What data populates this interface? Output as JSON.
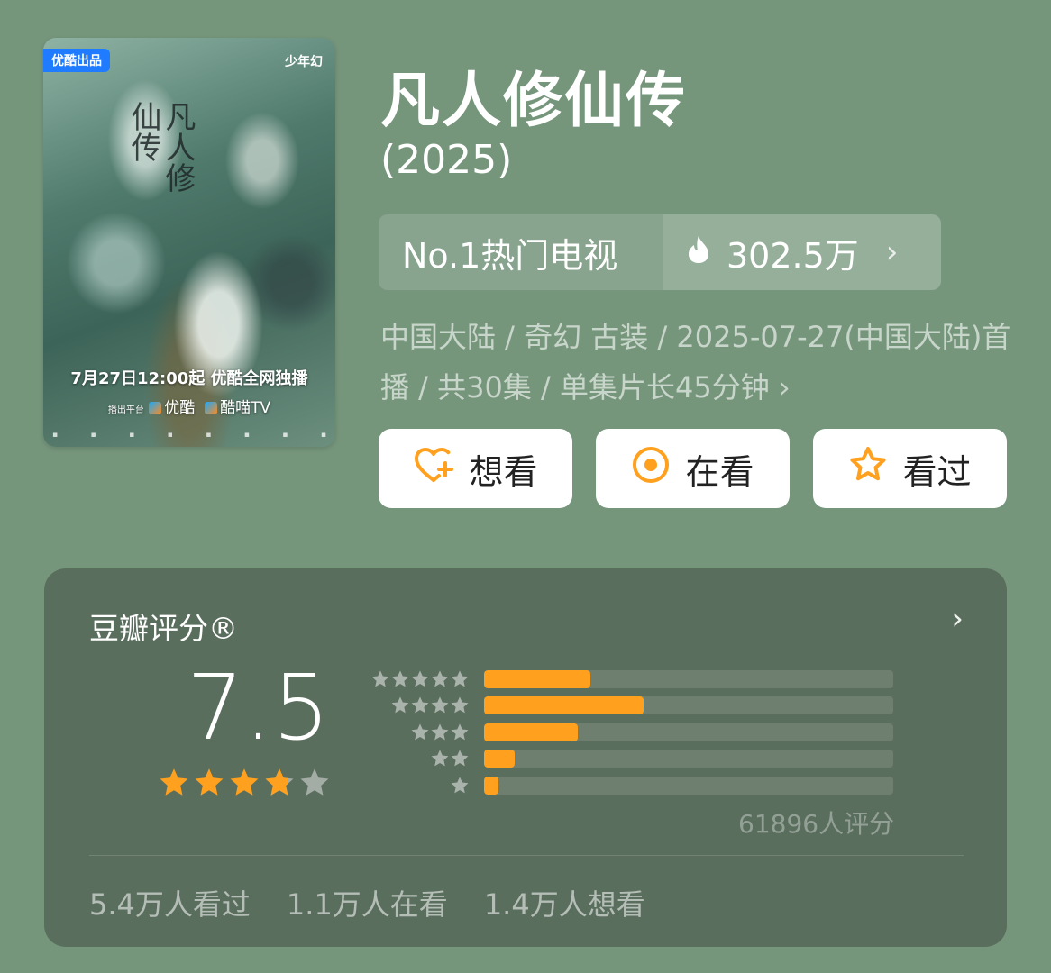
{
  "poster": {
    "badge": "优酷出品",
    "brand": "少年幻",
    "title_art": "凡人修仙传",
    "release": "7月27日12:00起 优酷全网独播",
    "platform_prefix": "播出平台",
    "platform_1": "优酷",
    "platform_2": "酷喵TV"
  },
  "title": "凡人修仙传",
  "year": "(2025)",
  "rank": {
    "label": "No.1热门电视",
    "heat": "302.5万",
    "chevron": "›"
  },
  "meta": {
    "line": "中国大陆 / 奇幻 古装 / 2025-07-27(中国大陆)首播 / 共30集 / 单集片长45分钟 ›"
  },
  "actions": [
    {
      "label": "想看",
      "icon": "heart-plus-icon"
    },
    {
      "label": "在看",
      "icon": "target-icon"
    },
    {
      "label": "看过",
      "icon": "star-outline-icon"
    }
  ],
  "rating": {
    "title": "豆瓣评分®",
    "chevron": "›",
    "score": "7.5",
    "stars": 3.75,
    "distribution": [
      {
        "stars": 5,
        "fraction": 0.26
      },
      {
        "stars": 4,
        "fraction": 0.39
      },
      {
        "stars": 3,
        "fraction": 0.23
      },
      {
        "stars": 2,
        "fraction": 0.075
      },
      {
        "stars": 1,
        "fraction": 0.035
      }
    ],
    "raters": "61896人评分",
    "stats": [
      "5.4万人看过",
      "1.1万人在看",
      "1.4万人想看"
    ]
  },
  "colors": {
    "background": "#76967c",
    "accent": "#ffa01e",
    "card": "#5a6e5d"
  }
}
